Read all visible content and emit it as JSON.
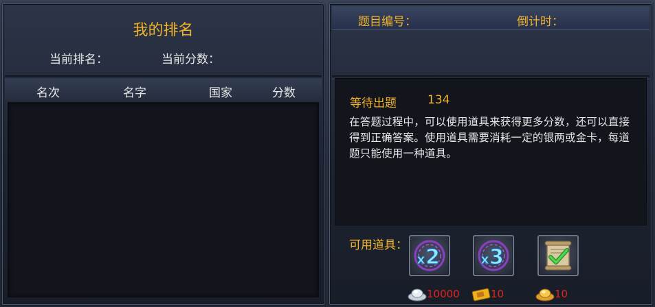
{
  "ranking_panel": {
    "title": "我的排名",
    "current_rank_label": "当前排名：",
    "current_score_label": "当前分数：",
    "columns": [
      "名次",
      "名字",
      "国家",
      "分数"
    ],
    "rows": []
  },
  "quiz_panel": {
    "question_number_label": "题目编号：",
    "countdown_label": "倒计时：",
    "status_label": "等待出题",
    "status_value": "134",
    "description": "在答题过程中，可以使用道具来获得更多分数，还可以直接得到正确答案。使用道具需要消耗一定的银两或金卡，每道题只能使用一种道具。",
    "items_label": "可用道具：",
    "items": [
      {
        "icon": "double-score-icon",
        "cost_icon": "silver-ingot-icon",
        "cost": "10000"
      },
      {
        "icon": "triple-score-icon",
        "cost_icon": "gold-card-icon",
        "cost": "10"
      },
      {
        "icon": "answer-scroll-icon",
        "cost_icon": "gold-ingot-icon",
        "cost": "10"
      }
    ]
  },
  "colors": {
    "gold_text": "#f1b32a",
    "cost_red": "#e4241e"
  }
}
